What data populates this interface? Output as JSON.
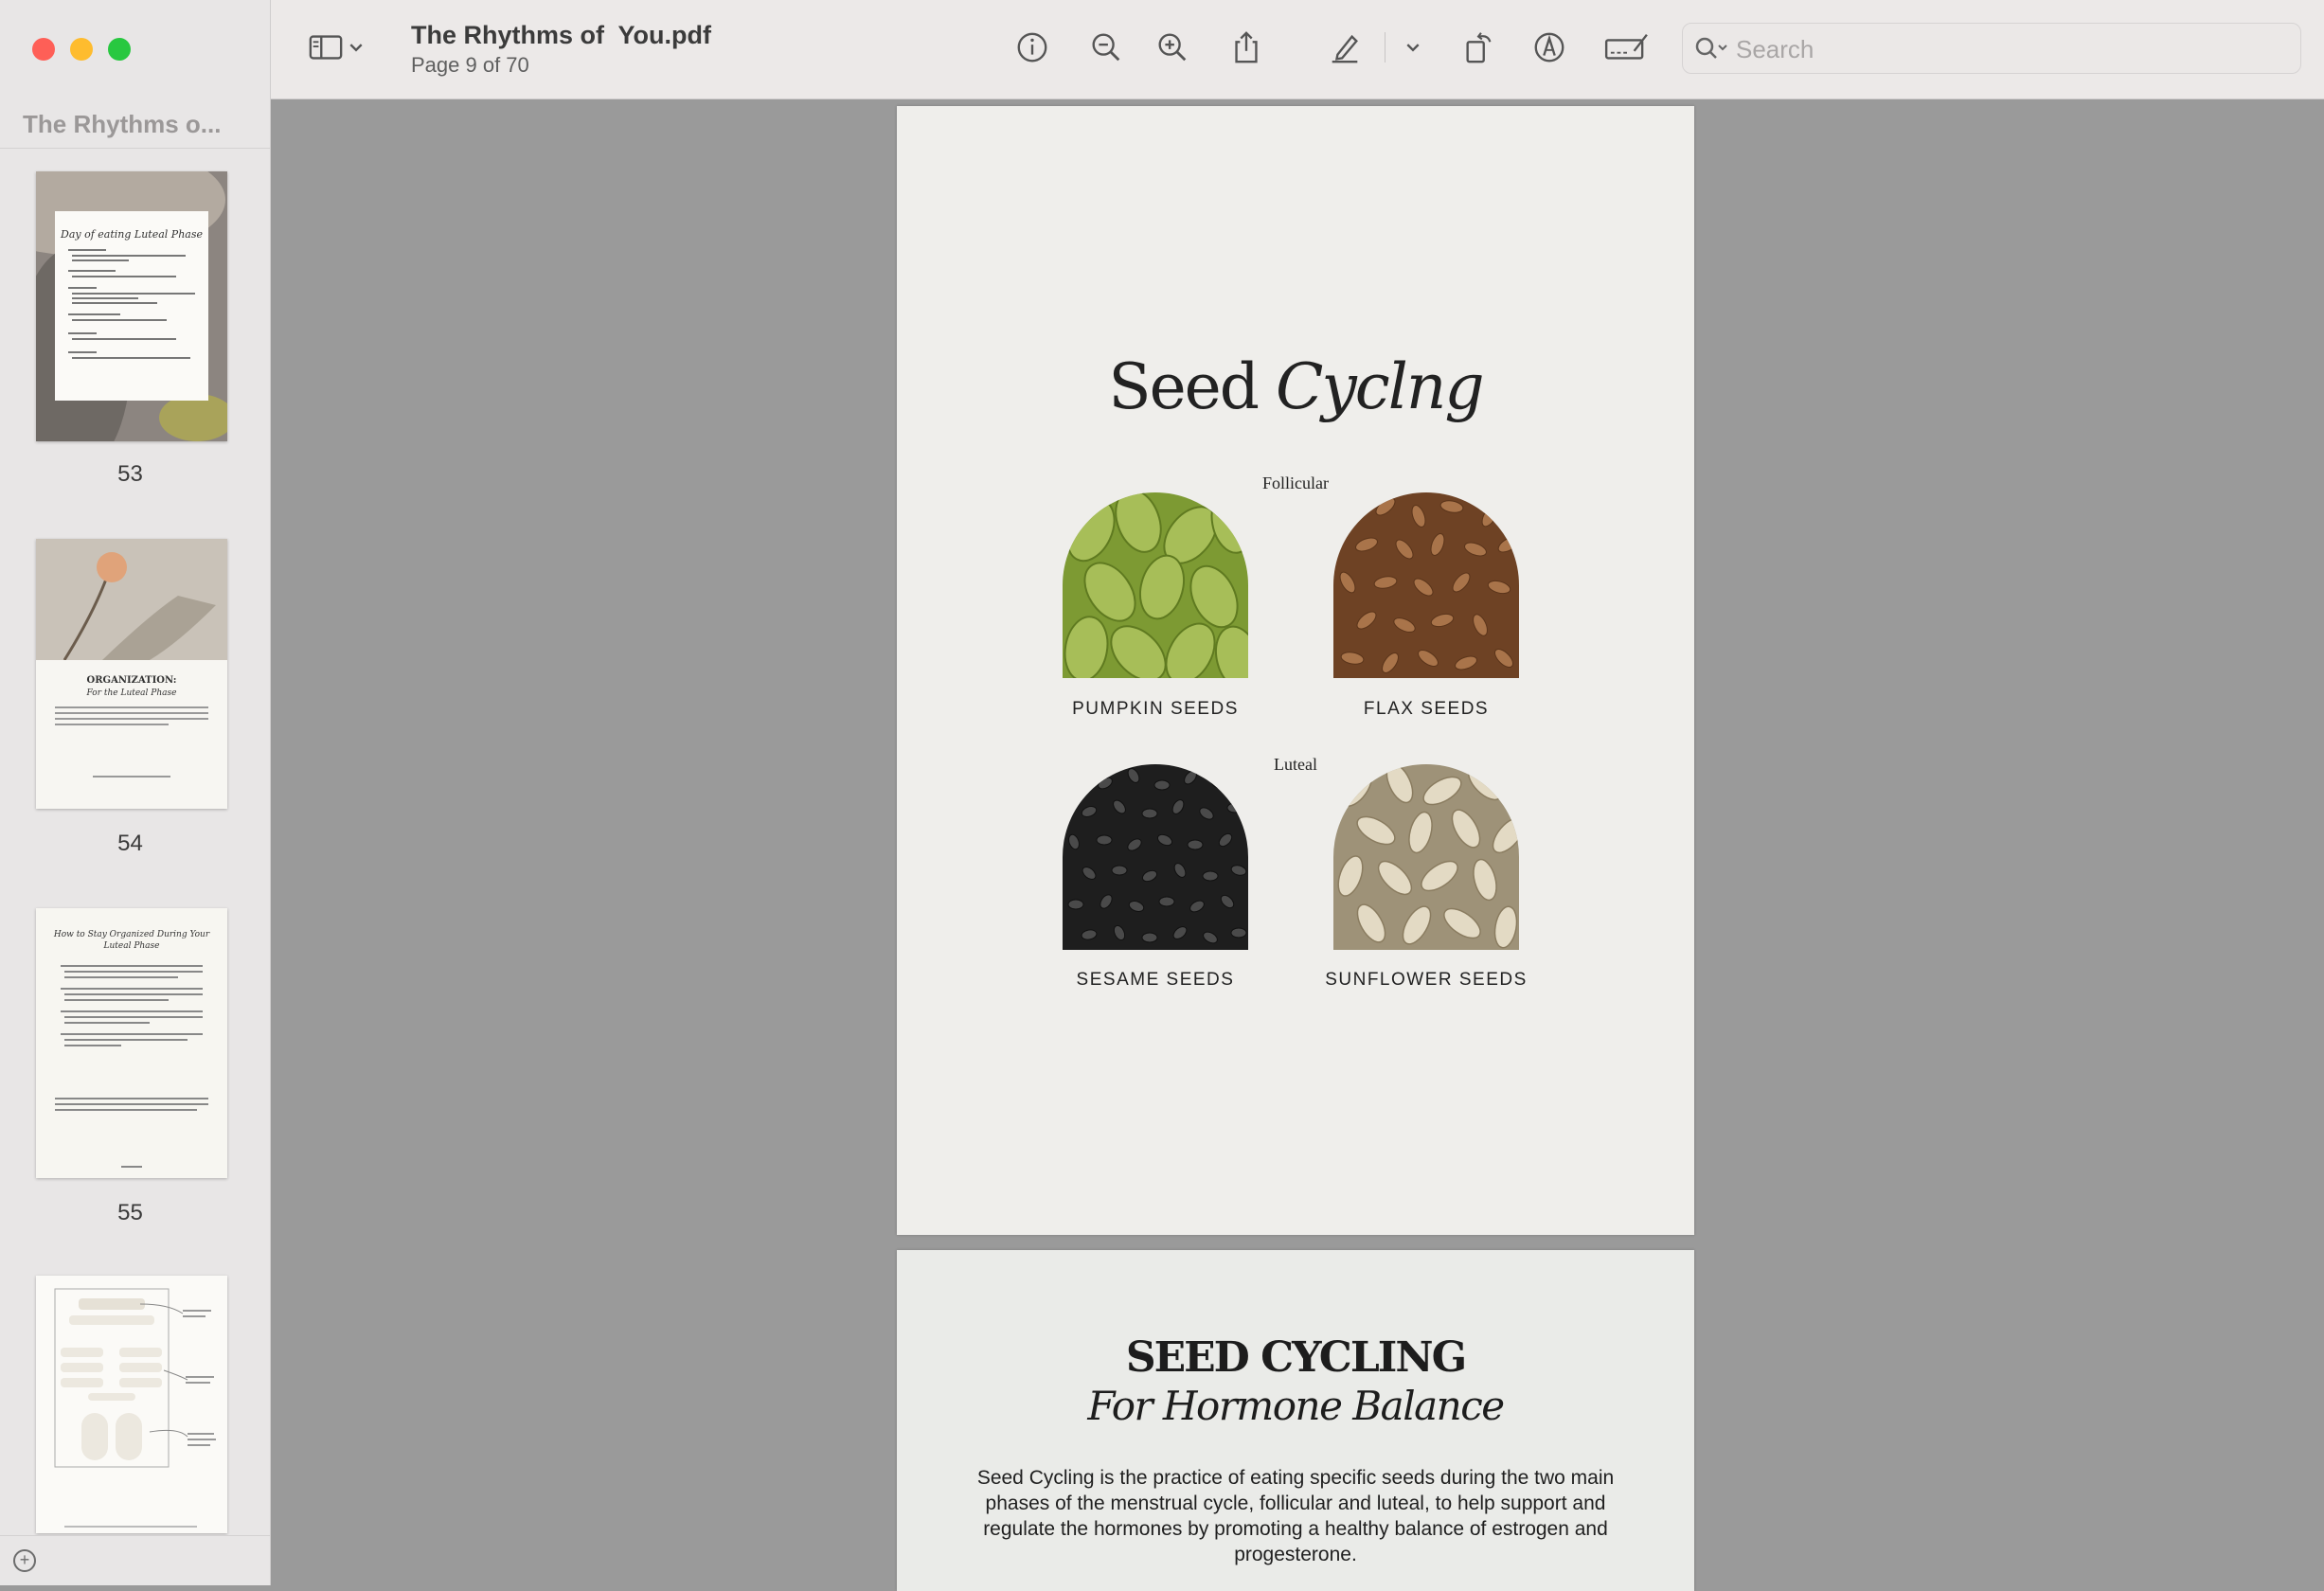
{
  "window": {
    "title": "The Rhythms of  You.pdf",
    "page_indicator": "Page 9 of 70"
  },
  "sidebar": {
    "title": "The Rhythms o...",
    "thumbnails": [
      {
        "page": "53",
        "heading": "Day of eating Luteal Phase"
      },
      {
        "page": "54",
        "heading": "ORGANIZATION:",
        "subheading": "For the Luteal Phase"
      },
      {
        "page": "55",
        "heading": "How to Stay Organized During Your Luteal Phase"
      },
      {
        "page": ""
      }
    ]
  },
  "toolbar": {
    "icons": [
      "sidebar-toggle-icon",
      "chevron-down-icon",
      "info-icon",
      "zoom-out-icon",
      "zoom-in-icon",
      "share-icon",
      "highlight-pen-icon",
      "chevron-down-icon",
      "rotate-icon",
      "markup-icon",
      "signature-icon"
    ],
    "search_placeholder": "Search"
  },
  "page_seed_cycling": {
    "title_regular": "Seed ",
    "title_italic": "Cyclng",
    "phase_follicular": "Follicular",
    "phase_luteal": "Luteal",
    "seeds": [
      {
        "label": "PUMPKIN SEEDS",
        "color": "#8aa03a"
      },
      {
        "label": "FLAX SEEDS",
        "color": "#8a5a32"
      },
      {
        "label": "SESAME SEEDS",
        "color": "#2a2a2a"
      },
      {
        "label": "SUNFLOWER SEEDS",
        "color": "#d7cdb6"
      }
    ]
  },
  "page_seed_cycling_2": {
    "title": "SEED CYCLING",
    "subtitle": "For Hormone Balance",
    "body": "Seed Cycling is the practice of eating specific seeds during the two main phases of the menstrual cycle, follicular and luteal, to help support and regulate the hormones by promoting a healthy balance of estrogen and progesterone."
  },
  "colors": {
    "close": "#fe5f57",
    "minimize": "#febc2e",
    "zoom": "#28c840"
  }
}
